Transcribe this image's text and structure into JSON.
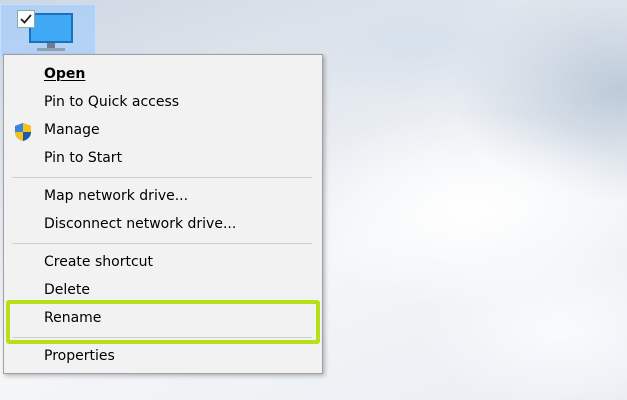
{
  "desktop_icon": {
    "checked": true,
    "icon": "computer-monitor-icon"
  },
  "menu": {
    "items": [
      {
        "label": "Open",
        "accel": "O",
        "bold": true
      },
      {
        "label": "Pin to Quick access"
      },
      {
        "label": "Manage",
        "icon": "uac-shield-icon"
      },
      {
        "label": "Pin to Start"
      },
      {
        "label": "Map network drive..."
      },
      {
        "label": "Disconnect network drive..."
      },
      {
        "label": "Create shortcut"
      },
      {
        "label": "Delete"
      },
      {
        "label": "Rename"
      },
      {
        "label": "Properties"
      }
    ]
  },
  "colors": {
    "highlight": "#b8e01a",
    "menu_bg": "#f2f2f2"
  }
}
